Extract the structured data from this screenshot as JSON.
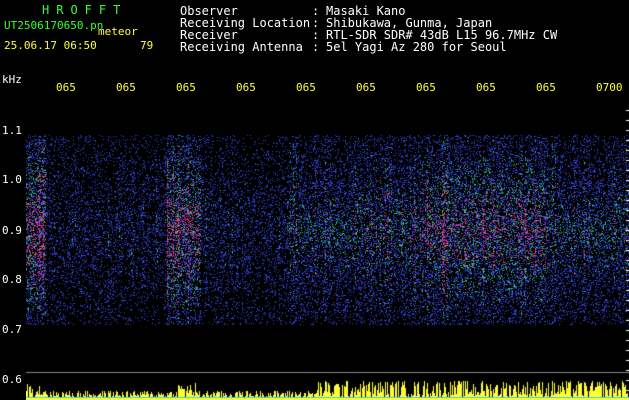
{
  "header": {
    "brand": "HROFFT",
    "filename": "UT2506170650.pn",
    "mode": "meteor",
    "datetime": "25.06.17 06:50",
    "count": "79"
  },
  "info": [
    {
      "label": "Observer",
      "value": "Masaki Kano"
    },
    {
      "label": "Receiving Location",
      "value": "Shibukawa, Gunma, Japan"
    },
    {
      "label": "Receiver",
      "value": "RTL-SDR SDR# 43dB L15 96.7MHz CW"
    },
    {
      "label": "Receiving Antenna",
      "value": "5el Yagi Az 280 for Seoul"
    }
  ],
  "axis": {
    "unit": "kHz",
    "freq_ticks": [
      "1.1",
      "1.0",
      "0.9",
      "0.8",
      "0.7",
      "0.6"
    ],
    "time_ticks": [
      "065",
      "065",
      "065",
      "065",
      "065",
      "065",
      "065",
      "065",
      "065",
      "0700"
    ]
  },
  "colors": {
    "background": "#000000",
    "green": "#33ff33",
    "yellow": "#ffff33",
    "strong": "#ff3377",
    "medium": "#33cc66",
    "weak": "#3344dd"
  }
}
